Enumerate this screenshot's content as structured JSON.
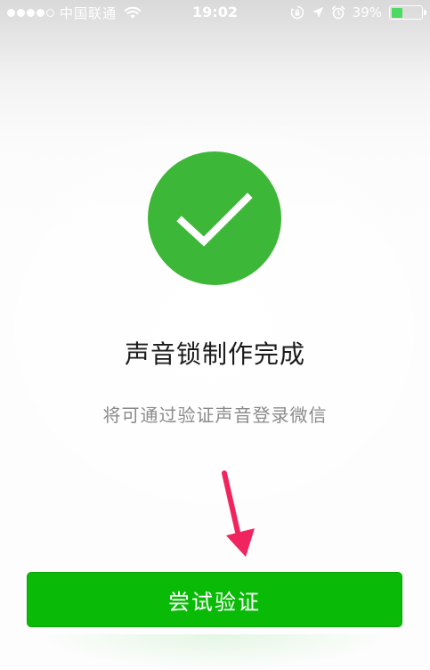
{
  "status_bar": {
    "carrier": "中国联通",
    "time": "19:02",
    "battery_percent": "39%",
    "battery_level": 0.39,
    "signal_bars_filled": 4,
    "signal_bars_total": 5
  },
  "result": {
    "title": "声音锁制作完成",
    "subtitle": "将可通过验证声音登录微信"
  },
  "actions": {
    "try_verify_label": "尝试验证"
  },
  "colors": {
    "success_circle": "#3db738",
    "primary_button": "#09bb07",
    "annotation_arrow": "#f0245e"
  },
  "icons": {
    "status": [
      "wifi-icon",
      "rotation-lock-icon",
      "location-arrow-icon",
      "alarm-clock-icon",
      "battery-icon"
    ],
    "result": "checkmark-icon",
    "annotation": "arrow-down-icon"
  }
}
